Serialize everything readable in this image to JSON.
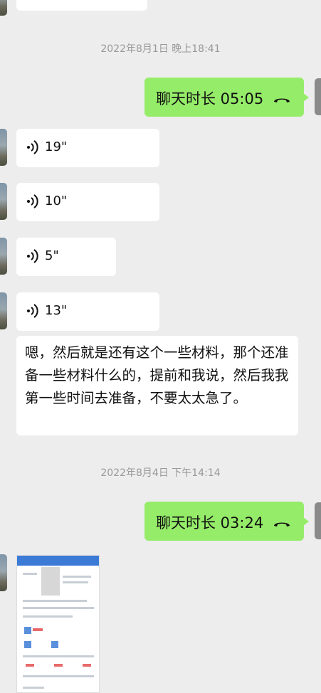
{
  "chat": {
    "timestamps": [
      "2022年8月1日 晚上18:41",
      "2022年8月4日 下午14:14"
    ],
    "calls": [
      {
        "label": "聊天时长 05:05",
        "icon": "phone-hangup-icon"
      },
      {
        "label": "聊天时长 03:24",
        "icon": "phone-hangup-icon"
      }
    ],
    "voices": [
      "19\"",
      "10\"",
      "5\"",
      "13\""
    ],
    "text_message": "嗯，然后就是还有这个一些材料，那个还准备一些材料什么的，提前和我说，然后我我第一些时间去准备，不要太太急了。",
    "image_message": {
      "icon": "screenshot-thumbnail"
    }
  },
  "colors": {
    "background": "#ededed",
    "incoming_bubble": "#ffffff",
    "outgoing_bubble": "#95ec69",
    "timestamp": "#999999"
  }
}
